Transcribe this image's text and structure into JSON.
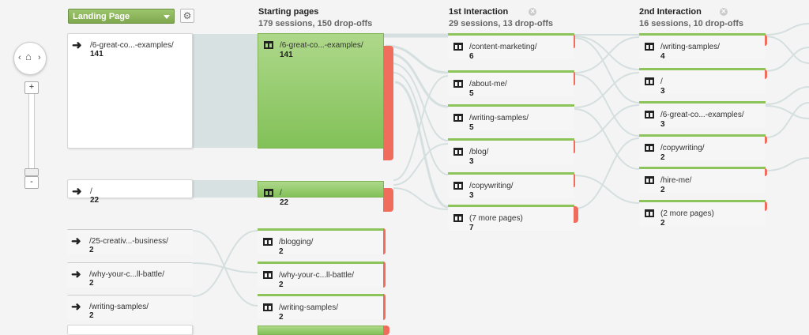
{
  "toolbar": {
    "dimension": "Landing Page",
    "gear_icon": "gear-icon",
    "zoom_in": "+",
    "zoom_out": "-"
  },
  "columns": [
    {
      "title": "Starting pages",
      "stats": "179 sessions, 150 drop-offs"
    },
    {
      "title": "1st Interaction",
      "stats": "29 sessions, 13 drop-offs"
    },
    {
      "title": "2nd Interaction",
      "stats": "16 sessions, 10 drop-offs"
    }
  ],
  "landing": [
    {
      "name": "/6-great-co...-examples/",
      "count": "141"
    },
    {
      "name": "/",
      "count": "22"
    },
    {
      "name": "/25-creativ...-business/",
      "count": "2"
    },
    {
      "name": "/why-your-c...ll-battle/",
      "count": "2"
    },
    {
      "name": "/writing-samples/",
      "count": "2"
    }
  ],
  "starting": [
    {
      "name": "/6-great-co...-examples/",
      "count": "141"
    },
    {
      "name": "/",
      "count": "22"
    },
    {
      "name": "/blogging/",
      "count": "2"
    },
    {
      "name": "/why-your-c...ll-battle/",
      "count": "2"
    },
    {
      "name": "/writing-samples/",
      "count": "2"
    }
  ],
  "first": [
    {
      "name": "/content-marketing/",
      "count": "6"
    },
    {
      "name": "/about-me/",
      "count": "5"
    },
    {
      "name": "/writing-samples/",
      "count": "5"
    },
    {
      "name": "/blog/",
      "count": "3"
    },
    {
      "name": "/copywriting/",
      "count": "3"
    },
    {
      "name": "(7 more pages)",
      "count": "7"
    }
  ],
  "second": [
    {
      "name": "/writing-samples/",
      "count": "4"
    },
    {
      "name": "/",
      "count": "3"
    },
    {
      "name": "/6-great-co...-examples/",
      "count": "3"
    },
    {
      "name": "/copywriting/",
      "count": "2"
    },
    {
      "name": "/hire-me/",
      "count": "2"
    },
    {
      "name": "(2 more pages)",
      "count": "2"
    }
  ],
  "colors": {
    "accent": "#8dc45a",
    "dropoff": "#f06d5d",
    "flow": "#d3dede"
  }
}
